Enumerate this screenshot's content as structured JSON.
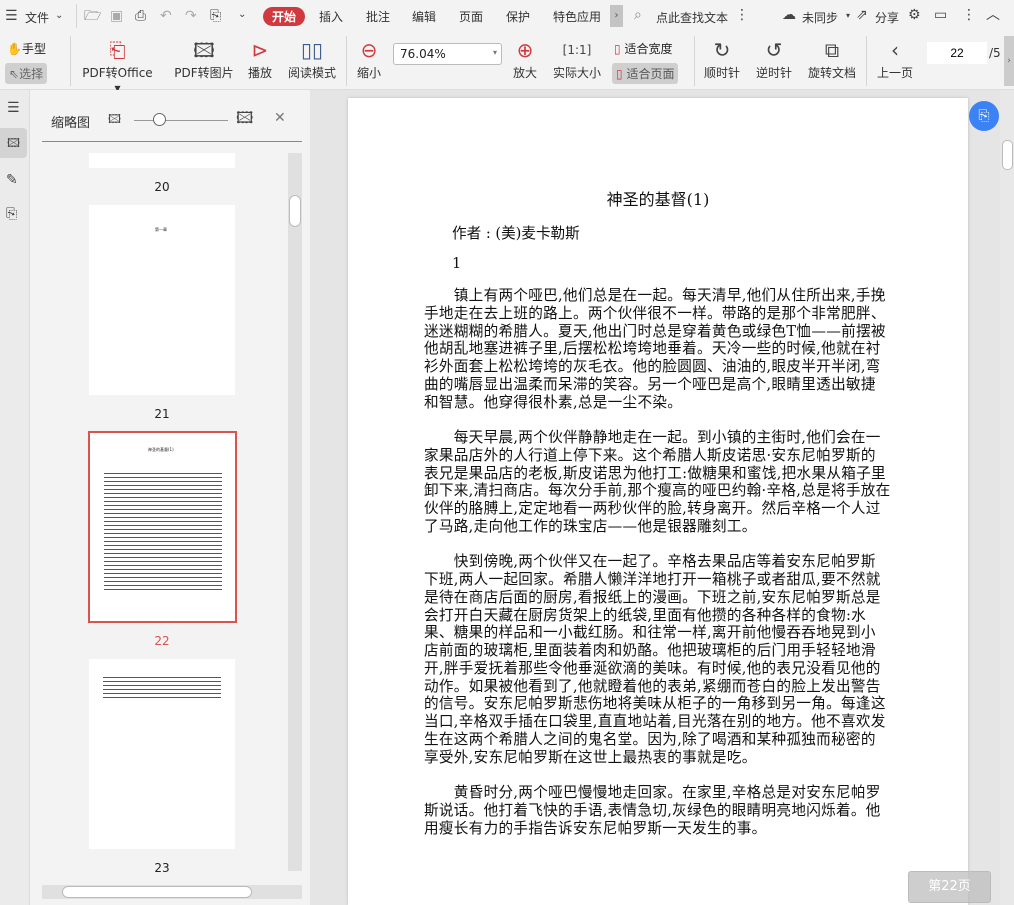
{
  "menu": {
    "file": "文件",
    "tabs": [
      "开始",
      "插入",
      "批注",
      "编辑",
      "页面",
      "保护",
      "特色应用"
    ],
    "search": "点此查找文本",
    "sync": "未同步",
    "share": "分享"
  },
  "ribbon": {
    "hand": "手型",
    "select": "选择",
    "pdf_office": "PDF转Office",
    "pdf_image": "PDF转图片",
    "play": "播放",
    "read_mode": "阅读模式",
    "zoom_out": "缩小",
    "zoom_value": "76.04%",
    "zoom_in": "放大",
    "actual_size": "实际大小",
    "fit_width": "适合宽度",
    "fit_page": "适合页面",
    "clockwise": "顺时针",
    "counter": "逆时针",
    "rotate_doc": "旋转文档",
    "prev_page": "上一页",
    "page_current": "22",
    "page_total": "/5"
  },
  "panel": {
    "title": "缩略图",
    "pages": [
      "20",
      "21",
      "22",
      "23"
    ],
    "thumb_titles": [
      "第一章",
      "神圣的基督(1)"
    ]
  },
  "document": {
    "title": "神圣的基督(1)",
    "author": "作者 : (美)麦卡勒斯",
    "chapter": "1",
    "lines": [
      "　　镇上有两个哑巴,他们总是在一起。每天清早,他们从住所出来,手挽",
      "手地走在去上班的路上。两个伙伴很不一样。带路的是那个非常肥胖、",
      "迷迷糊糊的希腊人。夏天,他出门时总是穿着黄色或绿色T恤——前摆被",
      "他胡乱地塞进裤子里,后摆松松垮垮地垂着。天冷一些的时候,他就在衬",
      "衫外面套上松松垮垮的灰毛衣。他的脸圆圆、油油的,眼皮半开半闭,弯",
      "曲的嘴唇显出温柔而呆滞的笑容。另一个哑巴是高个,眼睛里透出敏捷",
      "和智慧。他穿得很朴素,总是一尘不染。",
      "",
      "　　每天早晨,两个伙伴静静地走在一起。到小镇的主街时,他们会在一",
      "家果品店外的人行道上停下来。这个希腊人斯皮诺思·安东尼帕罗斯的",
      "表兄是果品店的老板,斯皮诺思为他打工:做糖果和蜜饯,把水果从箱子里",
      "卸下来,清扫商店。每次分手前,那个瘦高的哑巴约翰·辛格,总是将手放在",
      "伙伴的胳膊上,定定地看一两秒伙伴的脸,转身离开。然后辛格一个人过",
      "了马路,走向他工作的珠宝店——他是银器雕刻工。",
      "",
      "　　快到傍晚,两个伙伴又在一起了。辛格去果品店等着安东尼帕罗斯",
      "下班,两人一起回家。希腊人懒洋洋地打开一箱桃子或者甜瓜,要不然就",
      "是待在商店后面的厨房,看报纸上的漫画。下班之前,安东尼帕罗斯总是",
      "会打开白天藏在厨房货架上的纸袋,里面有他攒的各种各样的食物:水",
      "果、糖果的样品和一小截红肠。和往常一样,离开前他慢吞吞地晃到小",
      "店前面的玻璃柜,里面装着肉和奶酪。他把玻璃柜的后门用手轻轻地滑",
      "开,胖手爱抚着那些令他垂涎欲滴的美味。有时候,他的表兄没看见他的",
      "动作。如果被他看到了,他就瞪着他的表弟,紧绷而苍白的脸上发出警告",
      "的信号。安东尼帕罗斯悲伤地将美味从柜子的一角移到另一角。每逢这",
      "当口,辛格双手插在口袋里,直直地站着,目光落在别的地方。他不喜欢发",
      "生在这两个希腊人之间的鬼名堂。因为,除了喝酒和某种孤独而秘密的",
      "享受外,安东尼帕罗斯在这世上最热衷的事就是吃。",
      "",
      "　　黄昏时分,两个哑巴慢慢地走回家。在家里,辛格总是对安东尼帕罗",
      "斯说话。他打着飞快的手语,表情急切,灰绿色的眼睛明亮地闪烁着。他",
      "用瘦长有力的手指告诉安东尼帕罗斯一天发生的事。"
    ]
  },
  "page_badge": "第22页",
  "colors": {
    "accent": "#d0393e",
    "selected_page": "#d9534f"
  }
}
